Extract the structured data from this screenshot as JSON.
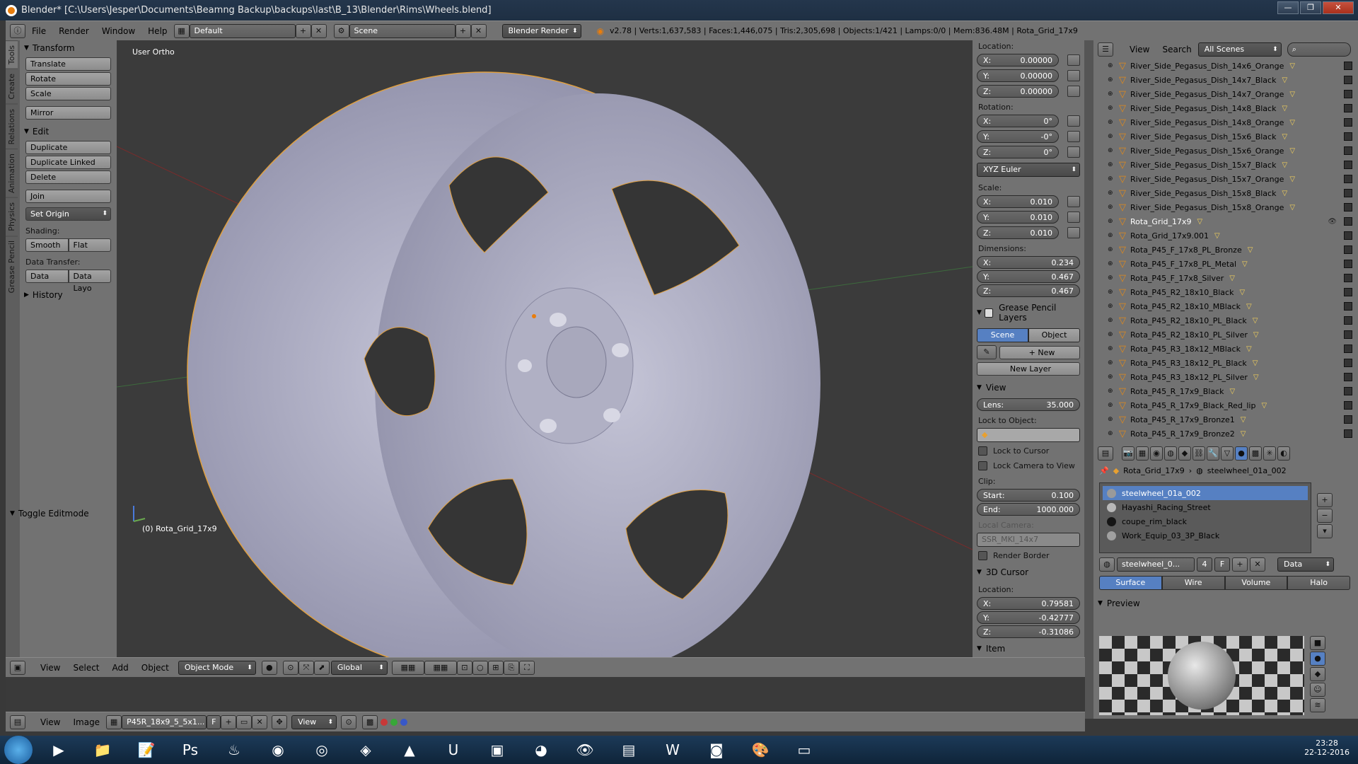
{
  "window": {
    "title": "Blender* [C:\\Users\\Jesper\\Documents\\Beamng Backup\\backups\\last\\B_13\\Blender\\Rims\\Wheels.blend]",
    "min": "—",
    "max": "❐",
    "close": "✕"
  },
  "topbar": {
    "menus": [
      "File",
      "Render",
      "Window",
      "Help"
    ],
    "layout": "Default",
    "scene": "Scene",
    "engine": "Blender Render",
    "stats": "v2.78 | Verts:1,637,583 | Faces:1,446,075 | Tris:2,305,698 | Objects:1/421 | Lamps:0/0 | Mem:836.48M | Rota_Grid_17x9"
  },
  "tool_tabs": [
    "Tools",
    "Create",
    "Relations",
    "Animation",
    "Physics",
    "Grease Pencil"
  ],
  "tools": {
    "transform_title": "Transform",
    "translate": "Translate",
    "rotate": "Rotate",
    "scale": "Scale",
    "mirror": "Mirror",
    "edit_title": "Edit",
    "duplicate": "Duplicate",
    "duplicate_linked": "Duplicate Linked",
    "delete": "Delete",
    "join": "Join",
    "set_origin": "Set Origin",
    "shading_label": "Shading:",
    "smooth": "Smooth",
    "flat": "Flat",
    "data_transfer_label": "Data Transfer:",
    "data": "Data",
    "data_layo": "Data Layo",
    "history_title": "History",
    "toggle_editmode": "Toggle Editmode"
  },
  "viewport": {
    "view_label": "User Ortho",
    "object_label": "(0) Rota_Grid_17x9"
  },
  "npanel": {
    "location_label": "Location:",
    "location": [
      {
        "axis": "X:",
        "value": "0.00000"
      },
      {
        "axis": "Y:",
        "value": "0.00000"
      },
      {
        "axis": "Z:",
        "value": "0.00000"
      }
    ],
    "rotation_label": "Rotation:",
    "rotation": [
      {
        "axis": "X:",
        "value": "0°"
      },
      {
        "axis": "Y:",
        "value": "-0°"
      },
      {
        "axis": "Z:",
        "value": "0°"
      }
    ],
    "rotation_mode": "XYZ Euler",
    "scale_label": "Scale:",
    "scale": [
      {
        "axis": "X:",
        "value": "0.010"
      },
      {
        "axis": "Y:",
        "value": "0.010"
      },
      {
        "axis": "Z:",
        "value": "0.010"
      }
    ],
    "dimensions_label": "Dimensions:",
    "dimensions": [
      {
        "axis": "X:",
        "value": "0.234"
      },
      {
        "axis": "Y:",
        "value": "0.467"
      },
      {
        "axis": "Z:",
        "value": "0.467"
      }
    ],
    "gp_layers": "Grease Pencil Layers",
    "gp_scene": "Scene",
    "gp_object": "Object",
    "gp_new": "New",
    "gp_new_layer": "New Layer",
    "view_title": "View",
    "lens_label": "Lens:",
    "lens": "35.000",
    "lock_to_object": "Lock to Object:",
    "lock_to_cursor": "Lock to Cursor",
    "lock_camera": "Lock Camera to View",
    "clip_label": "Clip:",
    "clip_start_label": "Start:",
    "clip_start": "0.100",
    "clip_end_label": "End:",
    "clip_end": "1000.000",
    "local_camera_label": "Local Camera:",
    "local_camera": "SSR_MKI_14x7",
    "render_border": "Render Border",
    "cursor_title": "3D Cursor",
    "cursor_location_label": "Location:",
    "cursor": [
      {
        "axis": "X:",
        "value": "0.79581"
      },
      {
        "axis": "Y:",
        "value": "-0.42777"
      },
      {
        "axis": "Z:",
        "value": "-0.31086"
      }
    ],
    "item_title": "Item"
  },
  "outliner": {
    "view": "View",
    "search": "Search",
    "filter": "All Scenes",
    "items": [
      "River_Side_Pegasus_Dish_14x6_Orange",
      "River_Side_Pegasus_Dish_14x7_Black",
      "River_Side_Pegasus_Dish_14x7_Orange",
      "River_Side_Pegasus_Dish_14x8_Black",
      "River_Side_Pegasus_Dish_14x8_Orange",
      "River_Side_Pegasus_Dish_15x6_Black",
      "River_Side_Pegasus_Dish_15x6_Orange",
      "River_Side_Pegasus_Dish_15x7_Black",
      "River_Side_Pegasus_Dish_15x7_Orange",
      "River_Side_Pegasus_Dish_15x8_Black",
      "River_Side_Pegasus_Dish_15x8_Orange",
      "Rota_Grid_17x9",
      "Rota_Grid_17x9.001",
      "Rota_P45_F_17x8_PL_Bronze",
      "Rota_P45_F_17x8_PL_Metal",
      "Rota_P45_F_17x8_Silver",
      "Rota_P45_R2_18x10_Black",
      "Rota_P45_R2_18x10_MBlack",
      "Rota_P45_R2_18x10_PL_Black",
      "Rota_P45_R2_18x10_PL_Silver",
      "Rota_P45_R3_18x12_MBlack",
      "Rota_P45_R3_18x12_PL_Black",
      "Rota_P45_R3_18x12_PL_Silver",
      "Rota_P45_R_17x9_Black",
      "Rota_P45_R_17x9_Black_Red_lip",
      "Rota_P45_R_17x9_Bronze1",
      "Rota_P45_R_17x9_Bronze2"
    ],
    "selected_index": 11
  },
  "properties": {
    "breadcrumb_object": "Rota_Grid_17x9",
    "breadcrumb_material": "steelwheel_01a_002",
    "materials": [
      {
        "name": "steelwheel_01a_002",
        "color": "#9a9a9a"
      },
      {
        "name": "Hayashi_Racing_Street",
        "color": "#b8b8b8"
      },
      {
        "name": "coupe_rim_black",
        "color": "#151515"
      },
      {
        "name": "Work_Equip_03_3P_Black",
        "color": "#a0a0a0"
      }
    ],
    "mat_field": "steelwheel_0...",
    "mat_users": "4",
    "mat_fake": "F",
    "link": "Data",
    "tabs": [
      "Surface",
      "Wire",
      "Volume",
      "Halo"
    ],
    "preview_title": "Preview"
  },
  "viewport_header": {
    "menus": [
      "View",
      "Select",
      "Add",
      "Object"
    ],
    "mode": "Object Mode",
    "orientation": "Global"
  },
  "image_header": {
    "menus": [
      "View",
      "Image"
    ],
    "image_name": "P45R_18x9_5_5x1...",
    "image_f": "F",
    "view": "View"
  },
  "taskbar": {
    "icons": [
      "media-icon",
      "folder-icon",
      "notepad-icon",
      "photoshop-icon",
      "steam-icon",
      "chrome-icon",
      "origin-icon",
      "unity-icon",
      "acrobat-icon",
      "uplay-icon",
      "office-icon",
      "blender-icon",
      "eye-icon",
      "calc-icon",
      "word-icon",
      "discord-icon",
      "paint-icon",
      "window-icon"
    ],
    "time": "23:28",
    "date": "22-12-2016"
  }
}
